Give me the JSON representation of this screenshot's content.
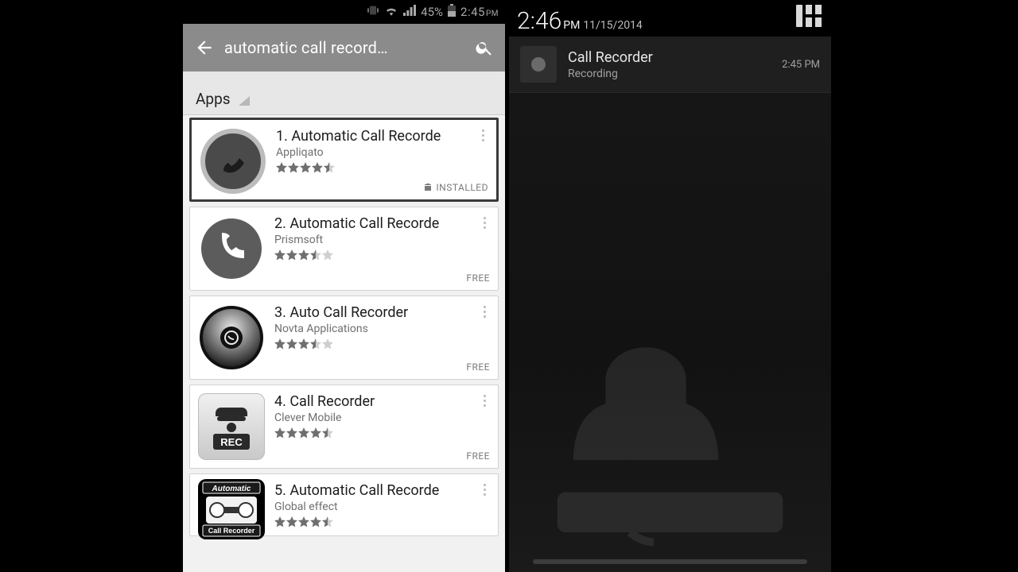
{
  "left": {
    "statusbar": {
      "battery_pct": "45%",
      "time": "2:45",
      "ampm": "PM"
    },
    "search_query": "automatic call record…",
    "tab_label": "Apps",
    "results": [
      {
        "title": "1. Automatic Call Recorde",
        "dev": "Appliqato",
        "rating": 4.5,
        "price": "INSTALLED",
        "installed": true
      },
      {
        "title": "2. Automatic Call Recorde",
        "dev": "Prismsoft",
        "rating": 3.5,
        "price": "FREE",
        "installed": false
      },
      {
        "title": "3. Auto Call Recorder",
        "dev": "Novta Applications",
        "rating": 3.5,
        "price": "FREE",
        "installed": false
      },
      {
        "title": "4. Call Recorder",
        "dev": "Clever Mobile",
        "rating": 4.5,
        "price": "FREE",
        "installed": false
      },
      {
        "title": "5. Automatic Call Recorde",
        "dev": "Global effect",
        "rating": 4.5,
        "price": "FREE",
        "installed": false
      }
    ],
    "icon_top_text": "Automatic",
    "icon_bottom_text": "Call Recorder",
    "icon_rec_text": "REC"
  },
  "right": {
    "time": "2:46",
    "ampm": "PM",
    "date": "11/15/2014",
    "notification": {
      "title": "Call Recorder",
      "subtitle": "Recording",
      "time": "2:45 PM"
    }
  }
}
